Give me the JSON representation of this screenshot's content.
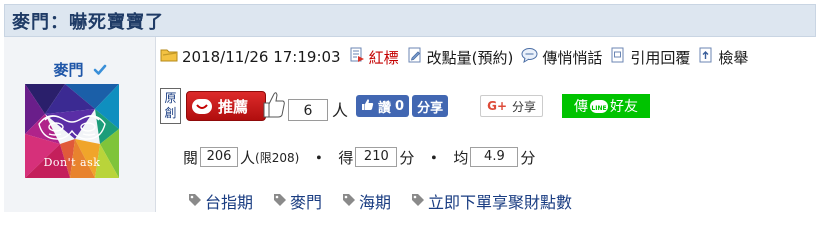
{
  "thread_title": "麥門：嚇死寶寶了",
  "author": {
    "name": "麥門",
    "avatar_caption": "Don't ask"
  },
  "post_meta": {
    "datetime": "2018/11/26 17:19:03",
    "actions": [
      {
        "label": "紅標",
        "icon": "red-flag-icon",
        "color": "#c40000"
      },
      {
        "label": "改點量(預約)",
        "icon": "edit-icon"
      },
      {
        "label": "傳悄悄話",
        "icon": "chat-bubble-icon"
      },
      {
        "label": "引用回覆",
        "icon": "quote-icon"
      },
      {
        "label": "檢舉",
        "icon": "report-icon"
      }
    ]
  },
  "engagement": {
    "original_badge": "原\n創",
    "recommend_label": "推薦",
    "recommend_count": "6",
    "recommend_unit": "人",
    "fb_like_label": "讚",
    "fb_like_count": "0",
    "fb_share_label": "分享",
    "google_share_label": "分享",
    "google_mark": "G+",
    "line_label_1": "傳",
    "line_label_2": "好友"
  },
  "stats": {
    "views_label": "閱",
    "views": "206",
    "views_unit": "人",
    "views_limit": "(限208)",
    "score_label": "得",
    "score": "210",
    "score_unit": "分",
    "avg_label": "均",
    "avg": "4.9",
    "avg_unit": "分",
    "separator": "・"
  },
  "tags": [
    "台指期",
    "麥門",
    "海期",
    "立即下單享聚財點數"
  ],
  "colors": {
    "title_bg": "#dde6f0",
    "title_text": "#1f3b66",
    "author_name": "#1f56a8",
    "recommend_red": "#c40000",
    "facebook_blue": "#4267b2",
    "line_green": "#00c300"
  }
}
